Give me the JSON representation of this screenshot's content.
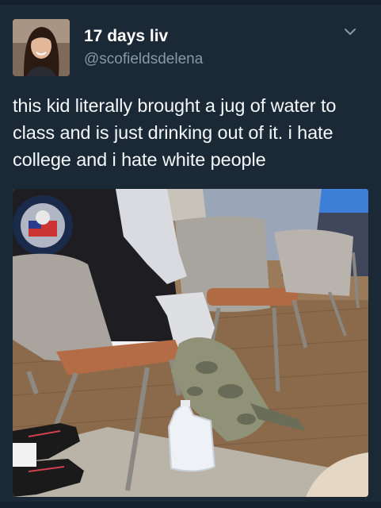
{
  "tweet": {
    "display_name": "17 days liv",
    "handle": "@scofieldsdelena",
    "text": "this kid literally brought a jug of water to class and is just drinking out of it. i hate college and i hate white people"
  },
  "icons": {
    "more": "chevron-down-icon",
    "avatar": "profile-photo"
  },
  "colors": {
    "background": "#1b2836",
    "name": "#ffffff",
    "handle": "#8899a6",
    "body_text": "#f5f8fa"
  }
}
